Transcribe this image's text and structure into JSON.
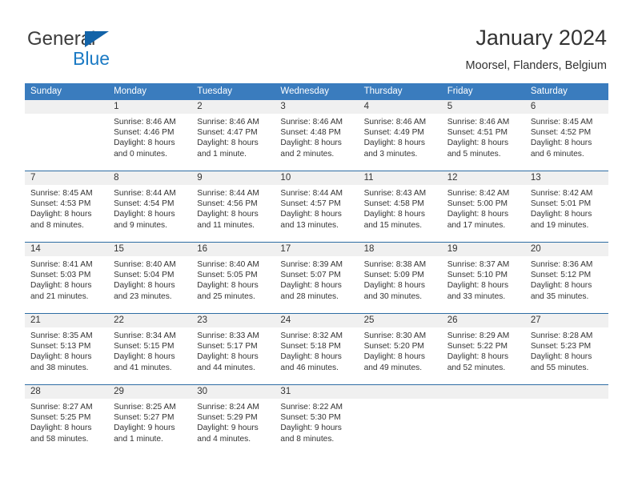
{
  "brand": {
    "name_part1": "General",
    "name_part2": "Blue",
    "color_dark": "#3c3c3c",
    "color_blue": "#1b7ac4"
  },
  "header": {
    "title": "January 2024",
    "subtitle": "Moorsel, Flanders, Belgium"
  },
  "calendar": {
    "header_bg": "#3a7cbe",
    "daynum_bg": "#f0f0f0",
    "row_divider": "#2e6da4",
    "weekdays": [
      "Sunday",
      "Monday",
      "Tuesday",
      "Wednesday",
      "Thursday",
      "Friday",
      "Saturday"
    ],
    "weeks": [
      [
        {
          "day": "",
          "lines": [
            "",
            "",
            "",
            ""
          ]
        },
        {
          "day": "1",
          "lines": [
            "Sunrise: 8:46 AM",
            "Sunset: 4:46 PM",
            "Daylight: 8 hours",
            "and 0 minutes."
          ]
        },
        {
          "day": "2",
          "lines": [
            "Sunrise: 8:46 AM",
            "Sunset: 4:47 PM",
            "Daylight: 8 hours",
            "and 1 minute."
          ]
        },
        {
          "day": "3",
          "lines": [
            "Sunrise: 8:46 AM",
            "Sunset: 4:48 PM",
            "Daylight: 8 hours",
            "and 2 minutes."
          ]
        },
        {
          "day": "4",
          "lines": [
            "Sunrise: 8:46 AM",
            "Sunset: 4:49 PM",
            "Daylight: 8 hours",
            "and 3 minutes."
          ]
        },
        {
          "day": "5",
          "lines": [
            "Sunrise: 8:46 AM",
            "Sunset: 4:51 PM",
            "Daylight: 8 hours",
            "and 5 minutes."
          ]
        },
        {
          "day": "6",
          "lines": [
            "Sunrise: 8:45 AM",
            "Sunset: 4:52 PM",
            "Daylight: 8 hours",
            "and 6 minutes."
          ]
        }
      ],
      [
        {
          "day": "7",
          "lines": [
            "Sunrise: 8:45 AM",
            "Sunset: 4:53 PM",
            "Daylight: 8 hours",
            "and 8 minutes."
          ]
        },
        {
          "day": "8",
          "lines": [
            "Sunrise: 8:44 AM",
            "Sunset: 4:54 PM",
            "Daylight: 8 hours",
            "and 9 minutes."
          ]
        },
        {
          "day": "9",
          "lines": [
            "Sunrise: 8:44 AM",
            "Sunset: 4:56 PM",
            "Daylight: 8 hours",
            "and 11 minutes."
          ]
        },
        {
          "day": "10",
          "lines": [
            "Sunrise: 8:44 AM",
            "Sunset: 4:57 PM",
            "Daylight: 8 hours",
            "and 13 minutes."
          ]
        },
        {
          "day": "11",
          "lines": [
            "Sunrise: 8:43 AM",
            "Sunset: 4:58 PM",
            "Daylight: 8 hours",
            "and 15 minutes."
          ]
        },
        {
          "day": "12",
          "lines": [
            "Sunrise: 8:42 AM",
            "Sunset: 5:00 PM",
            "Daylight: 8 hours",
            "and 17 minutes."
          ]
        },
        {
          "day": "13",
          "lines": [
            "Sunrise: 8:42 AM",
            "Sunset: 5:01 PM",
            "Daylight: 8 hours",
            "and 19 minutes."
          ]
        }
      ],
      [
        {
          "day": "14",
          "lines": [
            "Sunrise: 8:41 AM",
            "Sunset: 5:03 PM",
            "Daylight: 8 hours",
            "and 21 minutes."
          ]
        },
        {
          "day": "15",
          "lines": [
            "Sunrise: 8:40 AM",
            "Sunset: 5:04 PM",
            "Daylight: 8 hours",
            "and 23 minutes."
          ]
        },
        {
          "day": "16",
          "lines": [
            "Sunrise: 8:40 AM",
            "Sunset: 5:05 PM",
            "Daylight: 8 hours",
            "and 25 minutes."
          ]
        },
        {
          "day": "17",
          "lines": [
            "Sunrise: 8:39 AM",
            "Sunset: 5:07 PM",
            "Daylight: 8 hours",
            "and 28 minutes."
          ]
        },
        {
          "day": "18",
          "lines": [
            "Sunrise: 8:38 AM",
            "Sunset: 5:09 PM",
            "Daylight: 8 hours",
            "and 30 minutes."
          ]
        },
        {
          "day": "19",
          "lines": [
            "Sunrise: 8:37 AM",
            "Sunset: 5:10 PM",
            "Daylight: 8 hours",
            "and 33 minutes."
          ]
        },
        {
          "day": "20",
          "lines": [
            "Sunrise: 8:36 AM",
            "Sunset: 5:12 PM",
            "Daylight: 8 hours",
            "and 35 minutes."
          ]
        }
      ],
      [
        {
          "day": "21",
          "lines": [
            "Sunrise: 8:35 AM",
            "Sunset: 5:13 PM",
            "Daylight: 8 hours",
            "and 38 minutes."
          ]
        },
        {
          "day": "22",
          "lines": [
            "Sunrise: 8:34 AM",
            "Sunset: 5:15 PM",
            "Daylight: 8 hours",
            "and 41 minutes."
          ]
        },
        {
          "day": "23",
          "lines": [
            "Sunrise: 8:33 AM",
            "Sunset: 5:17 PM",
            "Daylight: 8 hours",
            "and 44 minutes."
          ]
        },
        {
          "day": "24",
          "lines": [
            "Sunrise: 8:32 AM",
            "Sunset: 5:18 PM",
            "Daylight: 8 hours",
            "and 46 minutes."
          ]
        },
        {
          "day": "25",
          "lines": [
            "Sunrise: 8:30 AM",
            "Sunset: 5:20 PM",
            "Daylight: 8 hours",
            "and 49 minutes."
          ]
        },
        {
          "day": "26",
          "lines": [
            "Sunrise: 8:29 AM",
            "Sunset: 5:22 PM",
            "Daylight: 8 hours",
            "and 52 minutes."
          ]
        },
        {
          "day": "27",
          "lines": [
            "Sunrise: 8:28 AM",
            "Sunset: 5:23 PM",
            "Daylight: 8 hours",
            "and 55 minutes."
          ]
        }
      ],
      [
        {
          "day": "28",
          "lines": [
            "Sunrise: 8:27 AM",
            "Sunset: 5:25 PM",
            "Daylight: 8 hours",
            "and 58 minutes."
          ]
        },
        {
          "day": "29",
          "lines": [
            "Sunrise: 8:25 AM",
            "Sunset: 5:27 PM",
            "Daylight: 9 hours",
            "and 1 minute."
          ]
        },
        {
          "day": "30",
          "lines": [
            "Sunrise: 8:24 AM",
            "Sunset: 5:29 PM",
            "Daylight: 9 hours",
            "and 4 minutes."
          ]
        },
        {
          "day": "31",
          "lines": [
            "Sunrise: 8:22 AM",
            "Sunset: 5:30 PM",
            "Daylight: 9 hours",
            "and 8 minutes."
          ]
        },
        {
          "day": "",
          "lines": [
            "",
            "",
            "",
            ""
          ]
        },
        {
          "day": "",
          "lines": [
            "",
            "",
            "",
            ""
          ]
        },
        {
          "day": "",
          "lines": [
            "",
            "",
            "",
            ""
          ]
        }
      ]
    ]
  }
}
